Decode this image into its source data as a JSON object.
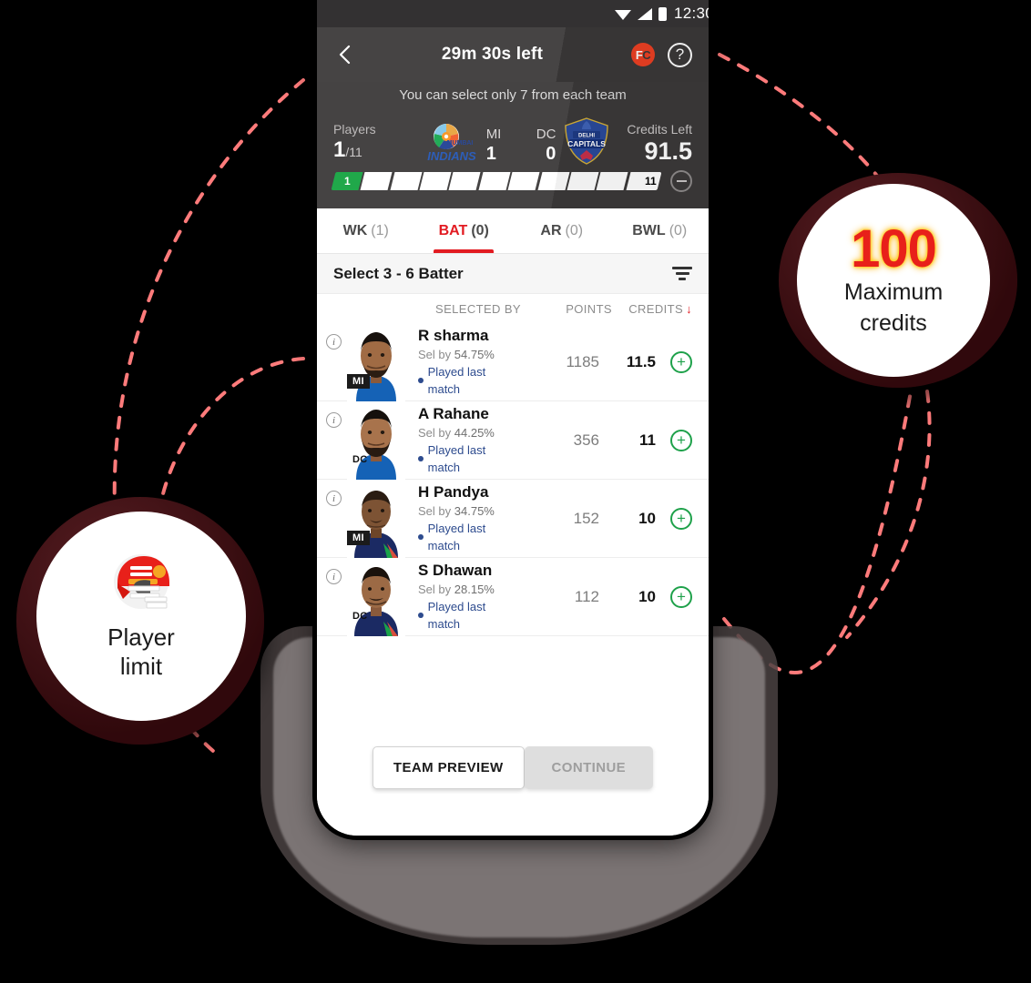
{
  "phone": {
    "statusbar": {
      "time": "12:30",
      "wifi_icon": "wifi-icon",
      "signal_icon": "signal-icon",
      "battery_icon": "battery-icon"
    },
    "appbar": {
      "back_icon": "back-chevron-icon",
      "title": "29m 30s left",
      "fc_badge_f": "F",
      "fc_badge_c": "C",
      "help_label": "?"
    },
    "hint": "You can select only 7 from each team",
    "stats": {
      "players_label": "Players",
      "players_value": "1",
      "players_total": "/11",
      "team1_code": "MI",
      "team1_count": "1",
      "team1_logo": "mumbai-indians-logo",
      "team2_code": "DC",
      "team2_count": "0",
      "team2_logo": "delhi-capitals-logo",
      "credits_label": "Credits Left",
      "credits_value": "91.5"
    },
    "progress": {
      "segments": 11,
      "filled": 1,
      "first_label": "1",
      "last_label": "11",
      "minus_icon": "minus-circle-icon"
    },
    "tabs": [
      {
        "label": "WK",
        "count": "(1)",
        "active": false
      },
      {
        "label": "BAT",
        "count": "(0)",
        "active": true
      },
      {
        "label": "AR",
        "count": "(0)",
        "active": false
      },
      {
        "label": "BWL",
        "count": "(0)",
        "active": false
      }
    ],
    "selectbar": {
      "title": "Select 3 - 6 Batter",
      "filter_icon": "filter-icon"
    },
    "columns": {
      "selected_by": "SELECTED BY",
      "points": "POINTS",
      "credits": "CREDITS",
      "sort_arrow": "↓"
    },
    "players": [
      {
        "name": "R sharma",
        "sel_prefix": "Sel by",
        "sel": "54.75%",
        "status": "Played last match",
        "points": "1185",
        "credits": "11.5",
        "team": "MI",
        "team_tag_dark": true
      },
      {
        "name": "A Rahane",
        "sel_prefix": "Sel by",
        "sel": "44.25%",
        "status": "Played last match",
        "points": "356",
        "credits": "11",
        "team": "DC",
        "team_tag_dark": false
      },
      {
        "name": "H Pandya",
        "sel_prefix": "Sel by",
        "sel": "34.75%",
        "status": "Played last match",
        "points": "152",
        "credits": "10",
        "team": "MI",
        "team_tag_dark": true
      },
      {
        "name": "S Dhawan",
        "sel_prefix": "Sel by",
        "sel": "28.15%",
        "status": "Played last match",
        "points": "112",
        "credits": "10",
        "team": "DC",
        "team_tag_dark": false
      }
    ],
    "footer": {
      "team_preview": "TEAM PREVIEW",
      "continue": "CONTINUE"
    }
  },
  "callouts": {
    "credits": {
      "number": "100",
      "line1": "Maximum",
      "line2": "credits"
    },
    "player": {
      "icon": "cricket-helmet-icon",
      "line1": "Player",
      "line2": "limit"
    }
  },
  "colors": {
    "accent_red": "#e21b22",
    "number_red": "#e8201a",
    "glow_yellow": "#ffd000",
    "green_add": "#1ea14a",
    "green_fill": "#14a340",
    "dark_panel": "#3b3939",
    "callout_ring": "#4a0d12",
    "connector": "#ff7b7b",
    "blue_link": "#2d4b8e"
  }
}
